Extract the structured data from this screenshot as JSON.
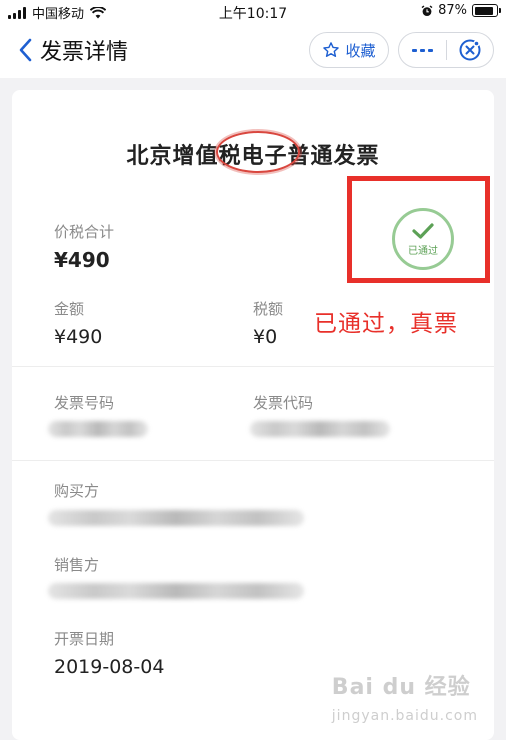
{
  "status_bar": {
    "carrier": "中国移动",
    "time": "上午10:17",
    "battery": "87%",
    "battery_level": 0.87
  },
  "nav": {
    "title": "发票详情",
    "favorite_label": "收藏",
    "icons": [
      "back-arrow-icon",
      "star-icon",
      "more-icon",
      "close-target-icon"
    ]
  },
  "invoice": {
    "title": "北京增值税电子普通发票",
    "total_label": "价税合计",
    "total_value": "¥490",
    "amount_label": "金额",
    "amount_value": "¥490",
    "tax_label": "税额",
    "tax_value": "¥0",
    "number_label": "发票号码",
    "code_label": "发票代码",
    "buyer_label": "购买方",
    "seller_label": "销售方",
    "date_label": "开票日期",
    "date_value": "2019-08-04",
    "stamp_text": "已通过"
  },
  "annotation": {
    "note": "已通过，真票",
    "color": "#e8302a"
  },
  "watermark": {
    "text": "Bai du 经验",
    "sub": "jingyan.baidu.com"
  },
  "colors": {
    "accent": "#1e5fd1",
    "stamp_green": "#4f9a48",
    "label_gray": "#8a8a8a"
  }
}
